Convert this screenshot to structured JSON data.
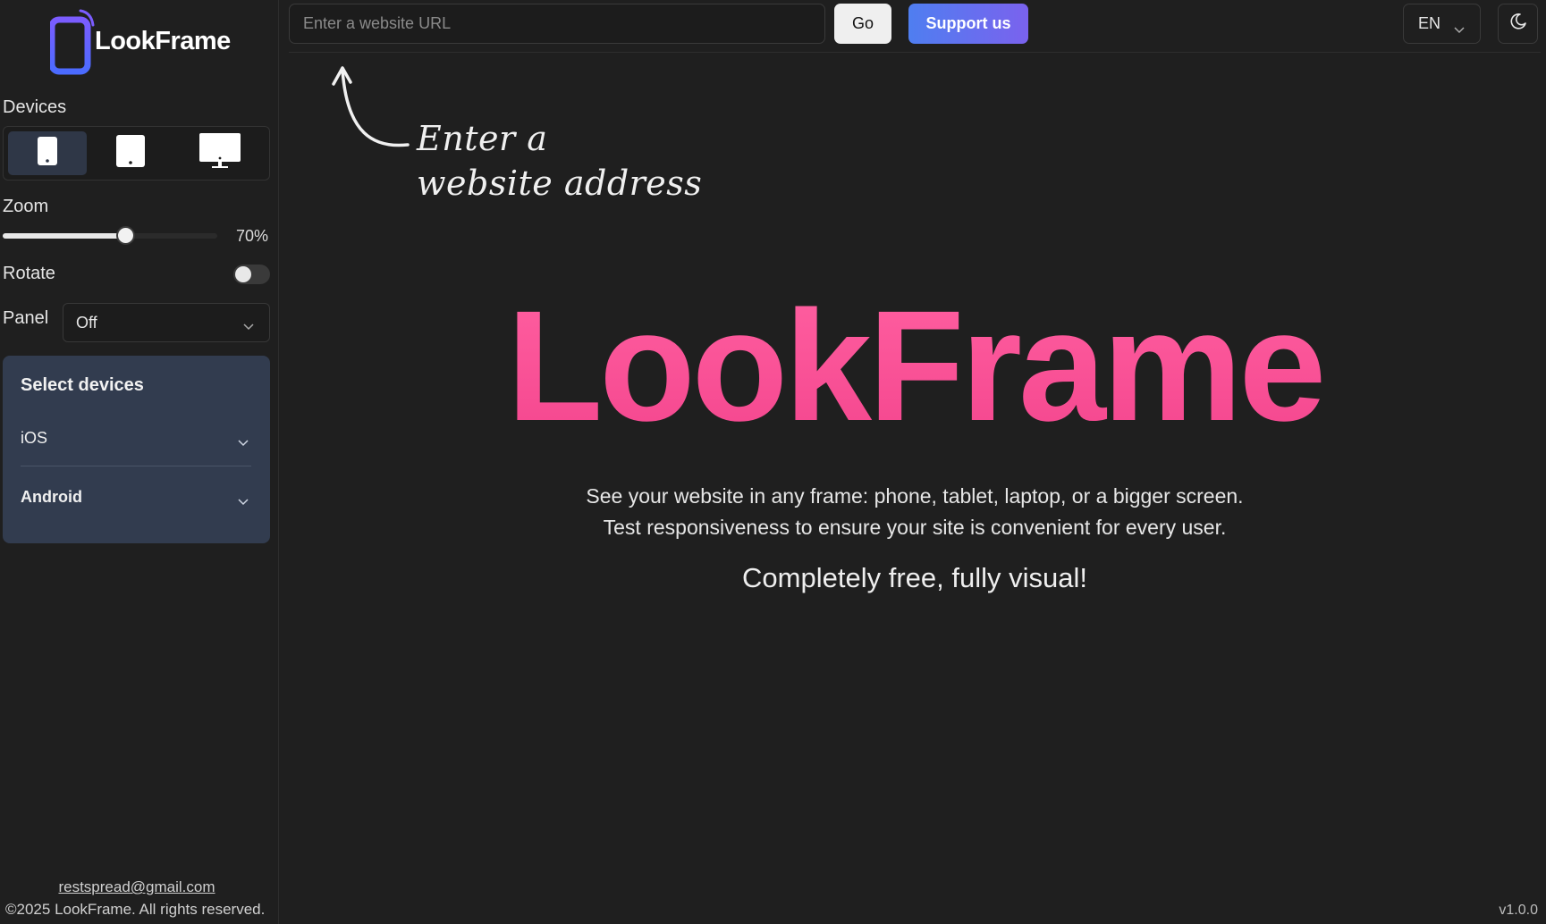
{
  "sidebar": {
    "logo_text": "LookFrame",
    "devices_label": "Devices",
    "device_buttons": [
      "phone",
      "tablet",
      "desktop"
    ],
    "zoom_label": "Zoom",
    "zoom_value": "70%",
    "zoom_percent": 70,
    "rotate_label": "Rotate",
    "rotate_on": false,
    "panel_label": "Panel",
    "panel_value": "Off",
    "select_devices": {
      "title": "Select devices",
      "groups": [
        {
          "label": "iOS"
        },
        {
          "label": "Android"
        }
      ]
    },
    "email": "restspread@gmail.com",
    "copyright": "©2025 LookFrame. All rights reserved."
  },
  "topbar": {
    "url_placeholder": "Enter a website URL",
    "go_label": "Go",
    "support_label": "Support us",
    "language": "EN"
  },
  "hint": {
    "line1": "Enter a",
    "line2": "website address"
  },
  "hero": {
    "title": "LookFrame",
    "subtitle_line1": "See your website in any frame: phone, tablet, laptop, or a bigger screen.",
    "subtitle_line2": "Test responsiveness to ensure your site is convenient for every user.",
    "tagline": "Completely free, fully visual!"
  },
  "version": "v1.0.0",
  "colors": {
    "background": "#1f1f1f",
    "accent_pink": "#f7549a",
    "panel_blue": "#323c4f",
    "support_gradient_start": "#4f7ef0",
    "support_gradient_end": "#7a62ee"
  }
}
